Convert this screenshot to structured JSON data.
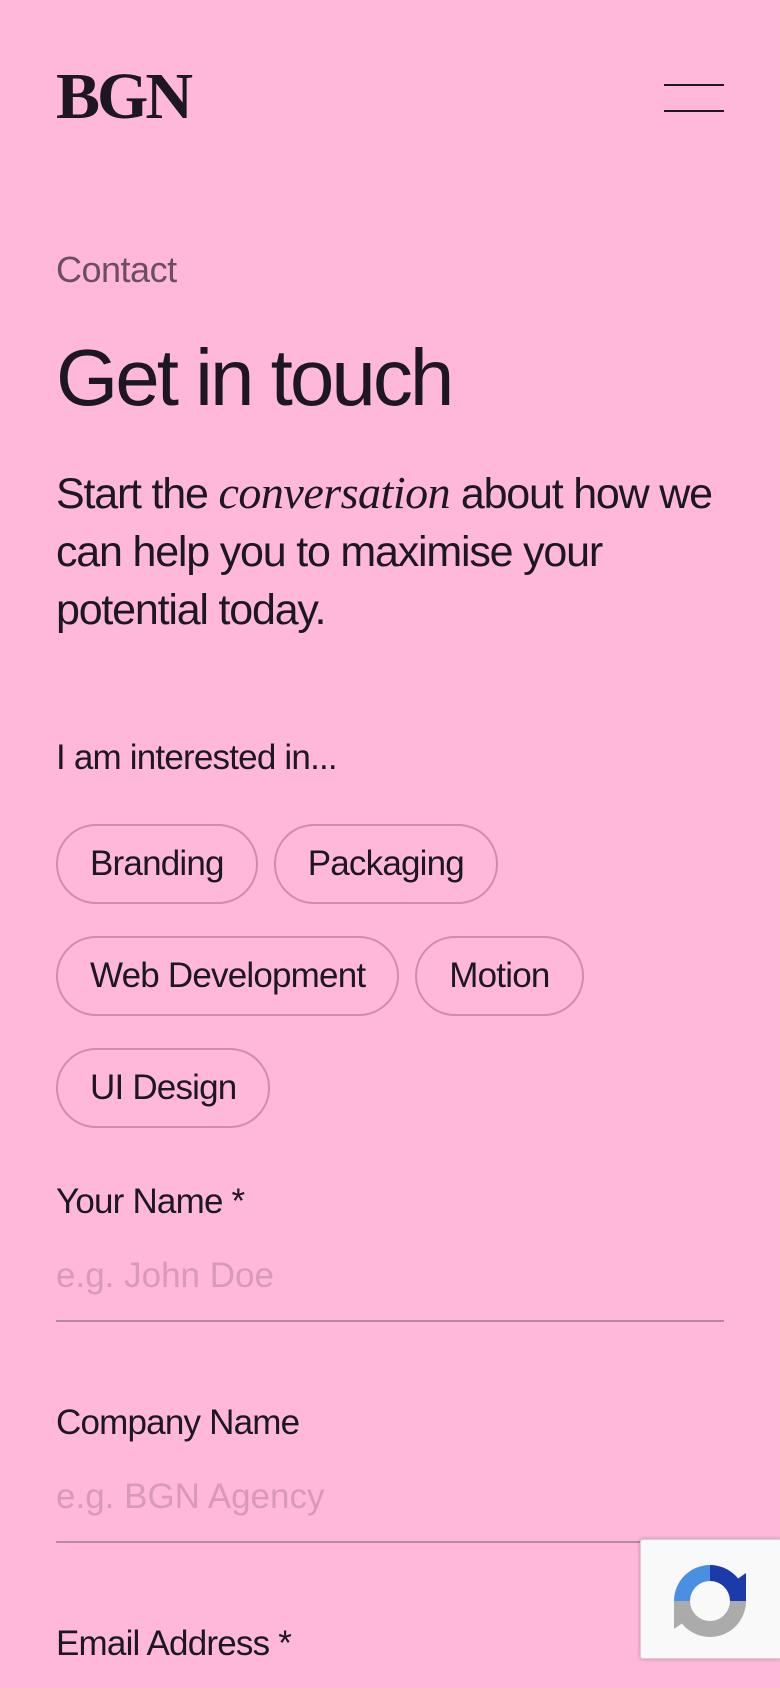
{
  "header": {
    "logo": "BGN",
    "menu_icon": "hamburger-menu-icon"
  },
  "hero": {
    "eyebrow": "Contact",
    "title": "Get in touch",
    "intro_before": "Start the ",
    "intro_emphasis": "conversation",
    "intro_after": " about how we can help you to maximise your potential today."
  },
  "interests": {
    "label": "I am interested in...",
    "options": [
      "Branding",
      "Packaging",
      "Web Development",
      "Motion",
      "UI Design"
    ]
  },
  "form": {
    "name": {
      "label": "Your Name *",
      "placeholder": "e.g. John Doe",
      "value": ""
    },
    "company": {
      "label": "Company Name",
      "placeholder": "e.g. BGN Agency",
      "value": ""
    },
    "email": {
      "label": "Email Address *"
    }
  },
  "recaptcha": {
    "icon": "recaptcha-icon"
  },
  "colors": {
    "background": "#ffb8d9",
    "text": "#1c1720",
    "muted_text": "#6b4f60",
    "placeholder": "#d99ab8",
    "chip_border": "#d48aa8"
  }
}
